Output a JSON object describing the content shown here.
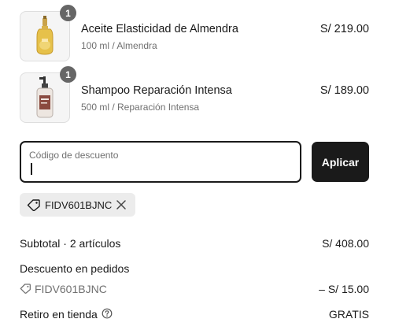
{
  "items": [
    {
      "title": "Aceite Elasticidad de Almendra",
      "variant": "100 ml / Almendra",
      "price": "S/ 219.00",
      "quantity": "1",
      "thumbnail_icon": "almond-oil-bottle-icon"
    },
    {
      "title": "Shampoo Reparación Intensa",
      "variant": "500 ml / Reparación Intensa",
      "price": "S/ 189.00",
      "quantity": "1",
      "thumbnail_icon": "shampoo-pump-bottle-icon"
    }
  ],
  "discount": {
    "field_label": "Código de descuento",
    "value": "",
    "apply_label": "Aplicar",
    "applied_code": "FIDV601BJNC"
  },
  "summary": {
    "subtotal_label": "Subtotal · 2 artículos",
    "subtotal_value": "S/ 408.00",
    "order_discount_label": "Descuento en pedidos",
    "discount_code": "FIDV601BJNC",
    "discount_value": "– S/ 15.00",
    "pickup_label": "Retiro en tienda",
    "pickup_value": "GRATIS"
  },
  "colors": {
    "primary": "#1a1a1a",
    "muted_text": "#707070",
    "chip_bg": "#ececec",
    "badge_bg": "#666666"
  }
}
